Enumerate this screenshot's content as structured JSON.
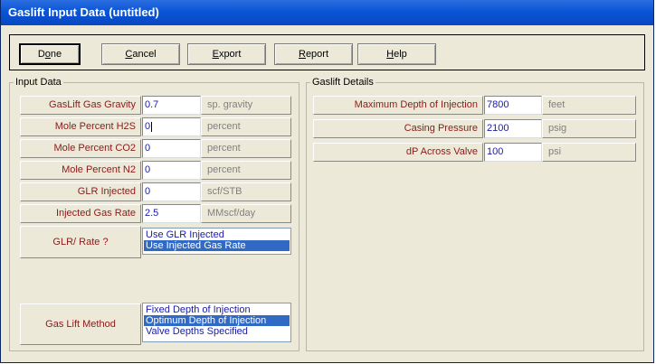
{
  "window": {
    "title": "Gaslift Input Data (untitled)"
  },
  "toolbar": {
    "done": {
      "pre": "D",
      "u": "o",
      "post": "ne"
    },
    "cancel": {
      "pre": "",
      "u": "C",
      "post": "ancel"
    },
    "export": {
      "pre": "",
      "u": "E",
      "post": "xport"
    },
    "report": {
      "pre": "",
      "u": "R",
      "post": "eport"
    },
    "help": {
      "pre": "",
      "u": "H",
      "post": "elp"
    }
  },
  "input_data": {
    "legend": "Input Data",
    "rows": [
      {
        "label": "GasLift Gas Gravity",
        "value": "0.7",
        "unit": "sp. gravity"
      },
      {
        "label": "Mole Percent H2S",
        "value": "0",
        "unit": "percent"
      },
      {
        "label": "Mole Percent CO2",
        "value": "0",
        "unit": "percent"
      },
      {
        "label": "Mole Percent N2",
        "value": "0",
        "unit": "percent"
      },
      {
        "label": "GLR Injected",
        "value": "0",
        "unit": "scf/STB"
      },
      {
        "label": "Injected Gas Rate",
        "value": "2.5",
        "unit": "MMscf/day"
      }
    ],
    "glr_rate": {
      "label": "GLR/ Rate ?",
      "options": [
        "Use GLR Injected",
        "Use Injected Gas Rate"
      ],
      "selected": "Use Injected Gas Rate"
    },
    "gas_lift_method": {
      "label": "Gas Lift Method",
      "options": [
        "Fixed Depth of Injection",
        "Optimum Depth of Injection",
        "Valve Depths Specified"
      ],
      "selected": "Optimum Depth of Injection"
    }
  },
  "gaslift_details": {
    "legend": "Gaslift Details",
    "rows": [
      {
        "label": "Maximum Depth of Injection",
        "value": "7800",
        "unit": "feet"
      },
      {
        "label": "Casing Pressure",
        "value": "2100",
        "unit": "psig"
      },
      {
        "label": "dP Across Valve",
        "value": "100",
        "unit": "psi"
      }
    ]
  },
  "colors": {
    "titlebar": "#0a55d6",
    "label_text": "#8b1a1a",
    "value_text": "#1a1aa8",
    "selection": "#316ac5"
  }
}
